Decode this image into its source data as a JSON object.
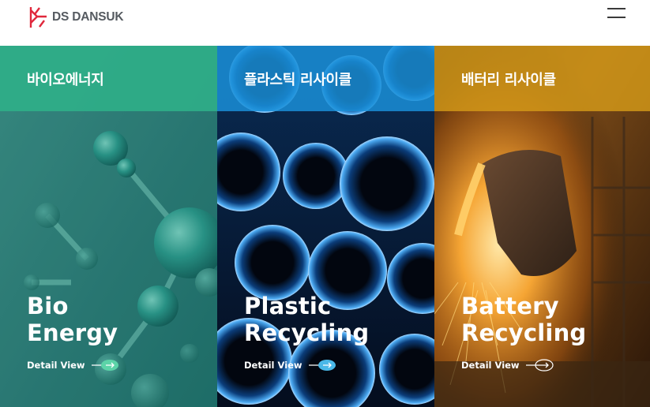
{
  "header": {
    "logo_text": "DS DANSUK",
    "menu_icon": "hamburger-menu-icon"
  },
  "panels": [
    {
      "band_label": "바이오에너지",
      "title_line1": "Bio",
      "title_line2": "Energy",
      "detail_label": "Detail View",
      "band_color": "#2fb089",
      "arrow_color": "#5cd4a8"
    },
    {
      "band_label": "플라스틱 리사이클",
      "title_line1": "Plastic",
      "title_line2": "Recycling",
      "detail_label": "Detail View",
      "band_color": "#1a8fd8",
      "arrow_color": "#4ab8e8"
    },
    {
      "band_label": "배터리 리사이클",
      "title_line1": "Battery",
      "title_line2": "Recycling",
      "detail_label": "Detail View",
      "band_color": "#d49a18",
      "arrow_color": "#ffffff"
    }
  ],
  "colors": {
    "brand_red": "#e0283c",
    "logo_gray": "#555a60"
  }
}
